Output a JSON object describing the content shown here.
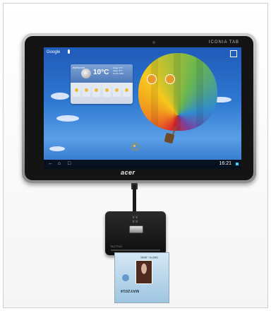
{
  "tablet": {
    "brand": "ICONIA TAB",
    "logo": "acer",
    "clock": "16:21",
    "search_label": "Google",
    "nav_icons": [
      "back-icon",
      "home-icon",
      "recent-apps-icon"
    ]
  },
  "weather_widget": {
    "city": "Karlsruhe",
    "temperature": "10°C",
    "details": "Hoge: 8°C\nLaag: 3°C\nVocht: 68%"
  },
  "reader": {
    "label": "TACTIVO"
  },
  "card": {
    "name": "SMITH, JANE",
    "expiry": "MAY2014"
  },
  "colors": {
    "screen_sky": "#2f79d2",
    "bezel": "#141414",
    "reader": "#1a1a1a",
    "card": "#b9d6ec"
  }
}
